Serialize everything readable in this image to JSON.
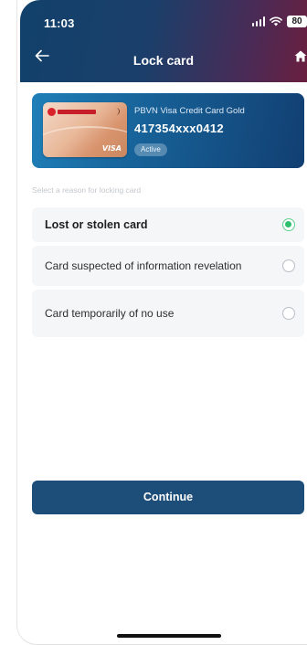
{
  "status_bar": {
    "time": "11:03",
    "battery": "80"
  },
  "header": {
    "title": "Lock card"
  },
  "card": {
    "name": "PBVN Visa Credit Card Gold",
    "number": "417354xxx0412",
    "status": "Active",
    "brand_mark": "VISA"
  },
  "reasons": {
    "section_label": "Select a reason for locking card",
    "items": [
      {
        "label": "Lost or stolen card",
        "selected": true
      },
      {
        "label": "Card suspected of information revelation",
        "selected": false
      },
      {
        "label": "Card temporarily of no use",
        "selected": false
      }
    ]
  },
  "actions": {
    "continue_label": "Continue"
  },
  "icons": [
    "back-arrow-icon",
    "home-icon",
    "signal-icon",
    "wifi-icon",
    "battery-icon",
    "radio-icon"
  ],
  "colors": {
    "header_start": "#11416b",
    "header_end": "#6a1f3f",
    "primary_button": "#1d4d79",
    "selected_radio": "#2ec06e",
    "card_banner": "#165f95"
  }
}
